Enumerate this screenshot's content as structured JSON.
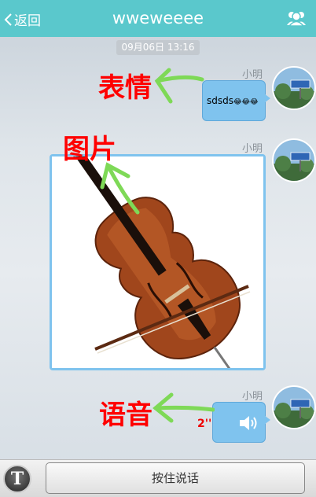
{
  "header": {
    "back_label": "返回",
    "title": "wweweeee",
    "group_icon": "group-icon"
  },
  "timestamp": "09月06日 13:16",
  "messages": [
    {
      "sender": "小明",
      "type": "text",
      "text": "sdsds",
      "emoji": "😂😂😂"
    },
    {
      "sender": "小明",
      "type": "image"
    },
    {
      "sender": "小明",
      "type": "voice",
      "duration": "2''"
    }
  ],
  "annotations": {
    "emoji_label": "表情",
    "image_label": "图片",
    "voice_label": "语音"
  },
  "input_bar": {
    "mode_toggle": "T",
    "talk_label": "按住说话"
  },
  "colors": {
    "header": "#5ac8cc",
    "bubble": "#7fc3ee",
    "annotation": "#ff0000",
    "arrow": "#7ed957"
  }
}
